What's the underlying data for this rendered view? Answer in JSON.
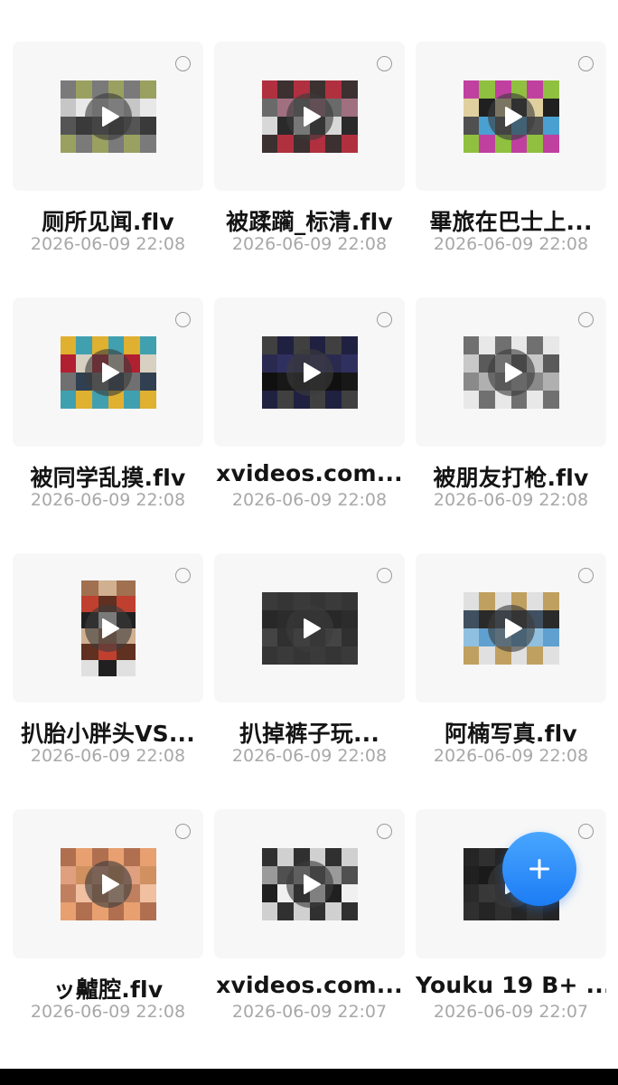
{
  "files": [
    {
      "name": "厕所见闻.flv",
      "date": "2026-06-09 22:08",
      "orientation": "landscape",
      "colors": [
        "#7a7a7a",
        "#c6c6c6",
        "#555555",
        "#9aa060",
        "#e8e8e8",
        "#3a3a3a"
      ]
    },
    {
      "name": "被蹂躏_标清.flv",
      "date": "2026-06-09 22:08",
      "orientation": "landscape",
      "colors": [
        "#2a2a2a",
        "#b03040",
        "#6a6a6a",
        "#d8d8d8",
        "#3c3030",
        "#a07080"
      ]
    },
    {
      "name": "畢旅在巴士上...",
      "date": "2026-06-09 22:08",
      "orientation": "landscape",
      "colors": [
        "#202020",
        "#4aa0d0",
        "#c040a0",
        "#e0d0a0",
        "#505050",
        "#90c040"
      ]
    },
    {
      "name": "被同学乱摸.flv",
      "date": "2026-06-09 22:08",
      "orientation": "landscape",
      "colors": [
        "#40a0b0",
        "#d8d0c0",
        "#304050",
        "#e0b030",
        "#b02030",
        "#707070"
      ]
    },
    {
      "name": "xvideos.com...",
      "date": "2026-06-09 22:08",
      "orientation": "landscape",
      "colors": [
        "#101010",
        "#202040",
        "#303060",
        "#181818",
        "#404040",
        "#2a2a50"
      ]
    },
    {
      "name": "被朋友打枪.flv",
      "date": "2026-06-09 22:08",
      "orientation": "landscape",
      "colors": [
        "#c8c8c8",
        "#8a8a8a",
        "#e8e8e8",
        "#5a5a5a",
        "#b0b0b0",
        "#707070"
      ]
    },
    {
      "name": "扒胎小胖头VS...",
      "date": "2026-06-09 22:08",
      "orientation": "portrait",
      "colors": [
        "#a07050",
        "#c04030",
        "#202020",
        "#d0b090",
        "#603020",
        "#e0e0e0"
      ]
    },
    {
      "name": "扒掉裤子玩...",
      "date": "2026-06-09 22:08",
      "orientation": "landscape",
      "colors": [
        "#303030",
        "#3a3a3a",
        "#282828",
        "#444444",
        "#353535",
        "#2c2c2c"
      ]
    },
    {
      "name": "阿楠写真.flv",
      "date": "2026-06-09 22:08",
      "orientation": "landscape",
      "colors": [
        "#2a2a2a",
        "#60a0d0",
        "#e0e0e0",
        "#405060",
        "#90c0e0",
        "#c0a060"
      ]
    },
    {
      "name": "ッ齇腔.flv",
      "date": "2026-06-09 22:08",
      "orientation": "landscape",
      "colors": [
        "#e8a070",
        "#d09060",
        "#f0c0a0",
        "#b07050",
        "#e0a080",
        "#c08060"
      ]
    },
    {
      "name": "xvideos.com...",
      "date": "2026-06-09 22:07",
      "orientation": "landscape",
      "colors": [
        "#202020",
        "#d0d0d0",
        "#505050",
        "#f0f0f0",
        "#303030",
        "#9a9a9a"
      ]
    },
    {
      "name": "Youku 19 B+ ...",
      "date": "2026-06-09 22:07",
      "orientation": "landscape",
      "colors": [
        "#202020",
        "#2a2a2a",
        "#303030",
        "#1a1a1a",
        "#383838",
        "#252525"
      ]
    }
  ],
  "fab": {
    "icon": "plus-icon",
    "color": "#2a8cf8"
  }
}
